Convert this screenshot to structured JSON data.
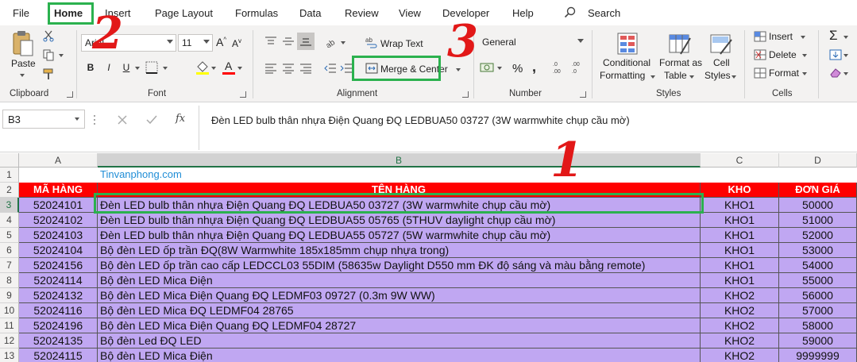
{
  "menu": {
    "items": [
      "File",
      "Home",
      "Insert",
      "Page Layout",
      "Formulas",
      "Data",
      "Review",
      "View",
      "Developer",
      "Help"
    ],
    "search_label": "Search"
  },
  "ribbon": {
    "clipboard": {
      "paste_label": "Paste",
      "group_label": "Clipboard"
    },
    "font": {
      "font_name": "Arial",
      "font_size": "11",
      "group_label": "Font",
      "bold": "B",
      "italic": "I",
      "underline": "U"
    },
    "alignment": {
      "wrap_text": "Wrap Text",
      "merge_center": "Merge & Center",
      "group_label": "Alignment"
    },
    "number": {
      "format": "General",
      "percent": "%",
      "comma": ",",
      "group_label": "Number"
    },
    "styles": {
      "conditional": "Conditional",
      "conditional2": "Formatting",
      "format_as": "Format as",
      "format_as2": "Table",
      "cell": "Cell",
      "cell2": "Styles",
      "group_label": "Styles"
    },
    "cells": {
      "insert": "Insert",
      "delete": "Delete",
      "format": "Format",
      "group_label": "Cells"
    }
  },
  "formula_bar": {
    "name_box": "B3",
    "fx": "fx",
    "content": "Đèn LED bulb thân nhựa Điện Quang ĐQ LEDBUA50 03727 (3W warmwhite chụp cầu mờ)"
  },
  "sheet": {
    "columns": [
      "A",
      "B",
      "C",
      "D"
    ],
    "row_numbers": [
      "1",
      "2",
      "3",
      "4",
      "5",
      "6",
      "7",
      "8",
      "9",
      "10",
      "11",
      "12",
      "13"
    ],
    "b1_text": "Tinvanphong.com",
    "headers": [
      "MÃ HÀNG",
      "TÊN HÀNG",
      "KHO",
      "ĐƠN GIÁ"
    ],
    "rows": [
      [
        "52024101",
        " Đèn LED bulb thân nhựa Điện Quang ĐQ LEDBUA50 03727 (3W warmwhite chụp cầu mờ)",
        "KHO1",
        "50000"
      ],
      [
        "52024102",
        " Đèn LED bulb thân nhựa Điện Quang ĐQ LEDBUA55 05765 (5THUV daylight chụp cầu mờ)",
        "KHO1",
        "51000"
      ],
      [
        "52024103",
        " Đèn LED bulb thân nhựa Điện Quang ĐQ LEDBUA55 05727 (5W warmwhite chụp cầu mờ)",
        "KHO1",
        "52000"
      ],
      [
        "52024104",
        " Bộ đèn LED ốp trần ĐQ(8W Warmwhite 185x185mm chụp nhựa trong)",
        "KHO1",
        "53000"
      ],
      [
        "52024156",
        "Bộ đèn LED ốp trần cao cấp LEDCCL03 55DIM (58635w Daylight D550 mm ĐK độ sáng và màu bằng remote)",
        "KHO1",
        "54000"
      ],
      [
        "52024114",
        " Bộ đèn LED Mica Điện",
        "KHO1",
        "55000"
      ],
      [
        "52024132",
        " Bộ đèn LED Mica Điện Quang ĐQ LEDMF03 09727 (0.3m 9W WW)",
        "KHO2",
        "56000"
      ],
      [
        "52024116",
        " Bộ đèn LED Mica ĐQ LEDMF04 28765",
        "KHO2",
        "57000"
      ],
      [
        "52024196",
        " Bộ đèn LED Mica Điện Quang ĐQ LEDMF04 28727",
        "KHO2",
        "58000"
      ],
      [
        "52024135",
        "Bộ đèn Led ĐQ LED",
        "KHO2",
        "59000"
      ],
      [
        "52024115",
        " Bộ đèn LED Mica Điện",
        "KHO2",
        "9999999"
      ]
    ]
  },
  "annotations": [
    "1",
    "2",
    "3"
  ],
  "colors": {
    "header_red": "#ff0000",
    "data_purple": "#c0a7f2",
    "highlight_green": "#2bb14e",
    "excel_green": "#217346"
  }
}
